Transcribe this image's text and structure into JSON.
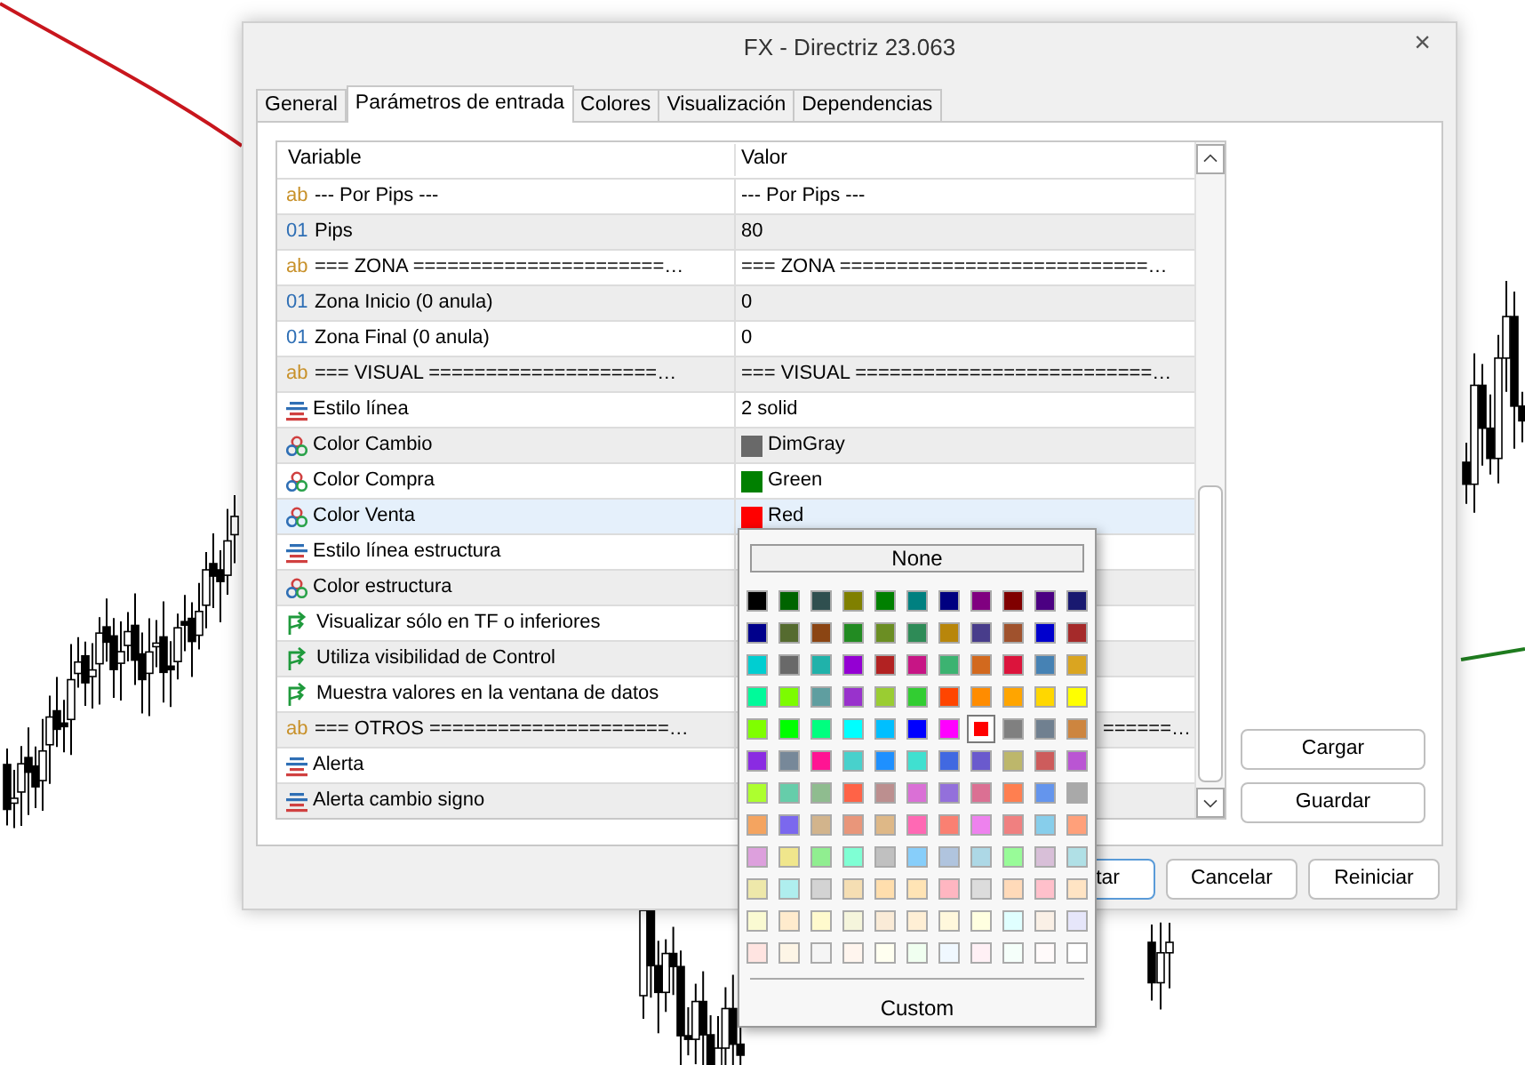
{
  "window": {
    "title": "FX - Directriz 23.063",
    "close": "×"
  },
  "tabs": [
    {
      "label": "General",
      "selected": false
    },
    {
      "label": "Parámetros de entrada",
      "selected": true
    },
    {
      "label": "Colores",
      "selected": false
    },
    {
      "label": "Visualización",
      "selected": false
    },
    {
      "label": "Dependencias",
      "selected": false
    }
  ],
  "table": {
    "columns": [
      "Variable",
      "Valor"
    ],
    "rows": [
      {
        "kind": "string",
        "badge": "ab",
        "variable": "--- Por Pips ---",
        "value": "--- Por Pips ---",
        "selected": false
      },
      {
        "kind": "int",
        "badge": "01",
        "variable": "Pips",
        "value": "80",
        "selected": false
      },
      {
        "kind": "string",
        "badge": "ab",
        "variable": "=== ZONA ======================…",
        "value": "=== ZONA ===========================…",
        "selected": false
      },
      {
        "kind": "int",
        "badge": "01",
        "variable": "Zona Inicio (0 anula)",
        "value": "0",
        "selected": false
      },
      {
        "kind": "int",
        "badge": "01",
        "variable": "Zona Final (0 anula)",
        "value": "0",
        "selected": false
      },
      {
        "kind": "string",
        "badge": "ab",
        "variable": "=== VISUAL ====================…",
        "value": "=== VISUAL ==========================…",
        "selected": false
      },
      {
        "kind": "enum",
        "variable": "Estilo línea",
        "value": "2 solid",
        "selected": false
      },
      {
        "kind": "color",
        "variable": "Color Cambio",
        "value": "DimGray",
        "color": "#696969",
        "selected": false
      },
      {
        "kind": "color",
        "variable": "Color Compra",
        "value": "Green",
        "color": "#008000",
        "selected": false
      },
      {
        "kind": "color",
        "variable": "Color Venta",
        "value": "Red",
        "color": "#ff0000",
        "selected": true
      },
      {
        "kind": "enum",
        "variable": "Estilo línea estructura",
        "selected": false
      },
      {
        "kind": "color",
        "variable": "Color estructura",
        "selected": false
      },
      {
        "kind": "bool",
        "variable": "Visualizar sólo en TF o inferiores",
        "selected": false
      },
      {
        "kind": "bool",
        "variable": "Utiliza visibilidad de Control",
        "selected": false
      },
      {
        "kind": "bool",
        "variable": "Muestra valores en la ventana de datos",
        "selected": false
      },
      {
        "kind": "string",
        "badge": "ab",
        "variable": "=== OTROS =====================…",
        "value": "======…",
        "selected": false
      },
      {
        "kind": "enum",
        "variable": "Alerta",
        "selected": false
      },
      {
        "kind": "enum",
        "variable": "Alerta cambio signo",
        "selected": false
      }
    ]
  },
  "side_buttons": [
    "Cargar",
    "Guardar"
  ],
  "footer_buttons": [
    "tar",
    "Cancelar",
    "Reiniciar"
  ],
  "color_picker": {
    "none_label": "None",
    "custom_label": "Custom",
    "swatches": [
      [
        {
          "color": "#000000",
          "selected": false
        },
        {
          "color": "#006400",
          "selected": false
        },
        {
          "color": "#2f4f4f",
          "selected": false
        },
        {
          "color": "#808000",
          "selected": false
        },
        {
          "color": "#008000",
          "selected": false
        },
        {
          "color": "#008080",
          "selected": false
        },
        {
          "color": "#000080",
          "selected": false
        },
        {
          "color": "#800080",
          "selected": false
        },
        {
          "color": "#800000",
          "selected": false
        },
        {
          "color": "#4b0082",
          "selected": false
        },
        {
          "color": "#191970",
          "selected": false
        }
      ],
      [
        {
          "color": "#00008b",
          "selected": false
        },
        {
          "color": "#556b2f",
          "selected": false
        },
        {
          "color": "#8b4513",
          "selected": false
        },
        {
          "color": "#228b22",
          "selected": false
        },
        {
          "color": "#6b8e23",
          "selected": false
        },
        {
          "color": "#2e8b57",
          "selected": false
        },
        {
          "color": "#b8860b",
          "selected": false
        },
        {
          "color": "#483d8b",
          "selected": false
        },
        {
          "color": "#a0522d",
          "selected": false
        },
        {
          "color": "#0000cd",
          "selected": false
        },
        {
          "color": "#a52a2a",
          "selected": false
        }
      ],
      [
        {
          "color": "#00ced1",
          "selected": false
        },
        {
          "color": "#696969",
          "selected": false
        },
        {
          "color": "#20b2aa",
          "selected": false
        },
        {
          "color": "#9400d3",
          "selected": false
        },
        {
          "color": "#b22222",
          "selected": false
        },
        {
          "color": "#c71585",
          "selected": false
        },
        {
          "color": "#3cb371",
          "selected": false
        },
        {
          "color": "#d2691e",
          "selected": false
        },
        {
          "color": "#dc143c",
          "selected": false
        },
        {
          "color": "#4682b4",
          "selected": false
        },
        {
          "color": "#daa520",
          "selected": false
        }
      ],
      [
        {
          "color": "#00fa9a",
          "selected": false
        },
        {
          "color": "#7cfc00",
          "selected": false
        },
        {
          "color": "#5f9ea0",
          "selected": false
        },
        {
          "color": "#9932cc",
          "selected": false
        },
        {
          "color": "#9acd32",
          "selected": false
        },
        {
          "color": "#32cd32",
          "selected": false
        },
        {
          "color": "#ff4500",
          "selected": false
        },
        {
          "color": "#ff8c00",
          "selected": false
        },
        {
          "color": "#ffa500",
          "selected": false
        },
        {
          "color": "#ffd700",
          "selected": false
        },
        {
          "color": "#ffff00",
          "selected": false
        }
      ],
      [
        {
          "color": "#7fff00",
          "selected": false
        },
        {
          "color": "#00ff00",
          "selected": false
        },
        {
          "color": "#00ff7f",
          "selected": false
        },
        {
          "color": "#00ffff",
          "selected": false
        },
        {
          "color": "#00bfff",
          "selected": false
        },
        {
          "color": "#0000ff",
          "selected": false
        },
        {
          "color": "#ff00ff",
          "selected": false
        },
        {
          "color": "#ff0000",
          "selected": true
        },
        {
          "color": "#808080",
          "selected": false
        },
        {
          "color": "#708090",
          "selected": false
        },
        {
          "color": "#cd853f",
          "selected": false
        }
      ],
      [
        {
          "color": "#8a2be2",
          "selected": false
        },
        {
          "color": "#778899",
          "selected": false
        },
        {
          "color": "#ff1493",
          "selected": false
        },
        {
          "color": "#48d1cc",
          "selected": false
        },
        {
          "color": "#1e90ff",
          "selected": false
        },
        {
          "color": "#40e0d0",
          "selected": false
        },
        {
          "color": "#4169e1",
          "selected": false
        },
        {
          "color": "#6a5acd",
          "selected": false
        },
        {
          "color": "#bdb76b",
          "selected": false
        },
        {
          "color": "#cd5c5c",
          "selected": false
        },
        {
          "color": "#ba55d3",
          "selected": false
        }
      ],
      [
        {
          "color": "#adff2f",
          "selected": false
        },
        {
          "color": "#66cdaa",
          "selected": false
        },
        {
          "color": "#8fbc8f",
          "selected": false
        },
        {
          "color": "#ff6347",
          "selected": false
        },
        {
          "color": "#bc8f8f",
          "selected": false
        },
        {
          "color": "#da70d6",
          "selected": false
        },
        {
          "color": "#9370db",
          "selected": false
        },
        {
          "color": "#db7093",
          "selected": false
        },
        {
          "color": "#ff7f50",
          "selected": false
        },
        {
          "color": "#6495ed",
          "selected": false
        },
        {
          "color": "#a9a9a9",
          "selected": false
        }
      ],
      [
        {
          "color": "#f4a460",
          "selected": false
        },
        {
          "color": "#7b68ee",
          "selected": false
        },
        {
          "color": "#d2b48c",
          "selected": false
        },
        {
          "color": "#e9967a",
          "selected": false
        },
        {
          "color": "#deb887",
          "selected": false
        },
        {
          "color": "#ff69b4",
          "selected": false
        },
        {
          "color": "#fa8072",
          "selected": false
        },
        {
          "color": "#ee82ee",
          "selected": false
        },
        {
          "color": "#f08080",
          "selected": false
        },
        {
          "color": "#87ceeb",
          "selected": false
        },
        {
          "color": "#ffa07a",
          "selected": false
        }
      ],
      [
        {
          "color": "#dda0dd",
          "selected": false
        },
        {
          "color": "#f0e68c",
          "selected": false
        },
        {
          "color": "#90ee90",
          "selected": false
        },
        {
          "color": "#7fffd4",
          "selected": false
        },
        {
          "color": "#c0c0c0",
          "selected": false
        },
        {
          "color": "#87cefa",
          "selected": false
        },
        {
          "color": "#b0c4de",
          "selected": false
        },
        {
          "color": "#add8e6",
          "selected": false
        },
        {
          "color": "#98fb98",
          "selected": false
        },
        {
          "color": "#d8bfd8",
          "selected": false
        },
        {
          "color": "#b0e0e6",
          "selected": false
        }
      ],
      [
        {
          "color": "#eee8aa",
          "selected": false
        },
        {
          "color": "#afeeee",
          "selected": false
        },
        {
          "color": "#d3d3d3",
          "selected": false
        },
        {
          "color": "#f5deb3",
          "selected": false
        },
        {
          "color": "#ffdead",
          "selected": false
        },
        {
          "color": "#ffe4b5",
          "selected": false
        },
        {
          "color": "#ffb6c1",
          "selected": false
        },
        {
          "color": "#dcdcdc",
          "selected": false
        },
        {
          "color": "#ffdab9",
          "selected": false
        },
        {
          "color": "#ffc0cb",
          "selected": false
        },
        {
          "color": "#ffe4c4",
          "selected": false
        }
      ],
      [
        {
          "color": "#fafad2",
          "selected": false
        },
        {
          "color": "#ffebcd",
          "selected": false
        },
        {
          "color": "#fffacd",
          "selected": false
        },
        {
          "color": "#f5f5dc",
          "selected": false
        },
        {
          "color": "#faebd7",
          "selected": false
        },
        {
          "color": "#ffefd5",
          "selected": false
        },
        {
          "color": "#fff8dc",
          "selected": false
        },
        {
          "color": "#ffffe0",
          "selected": false
        },
        {
          "color": "#e0ffff",
          "selected": false
        },
        {
          "color": "#faf0e6",
          "selected": false
        },
        {
          "color": "#e6e6fa",
          "selected": false
        }
      ],
      [
        {
          "color": "#ffe4e1",
          "selected": false
        },
        {
          "color": "#fdf5e6",
          "selected": false
        },
        {
          "color": "#f5f5f5",
          "selected": false
        },
        {
          "color": "#fff5ee",
          "selected": false
        },
        {
          "color": "#fffff0",
          "selected": false
        },
        {
          "color": "#f0fff0",
          "selected": false
        },
        {
          "color": "#f0f8ff",
          "selected": false
        },
        {
          "color": "#fff0f5",
          "selected": false
        },
        {
          "color": "#f5fffa",
          "selected": false
        },
        {
          "color": "#fffafa",
          "selected": false
        },
        {
          "color": "#ffffff",
          "selected": false
        }
      ]
    ]
  }
}
